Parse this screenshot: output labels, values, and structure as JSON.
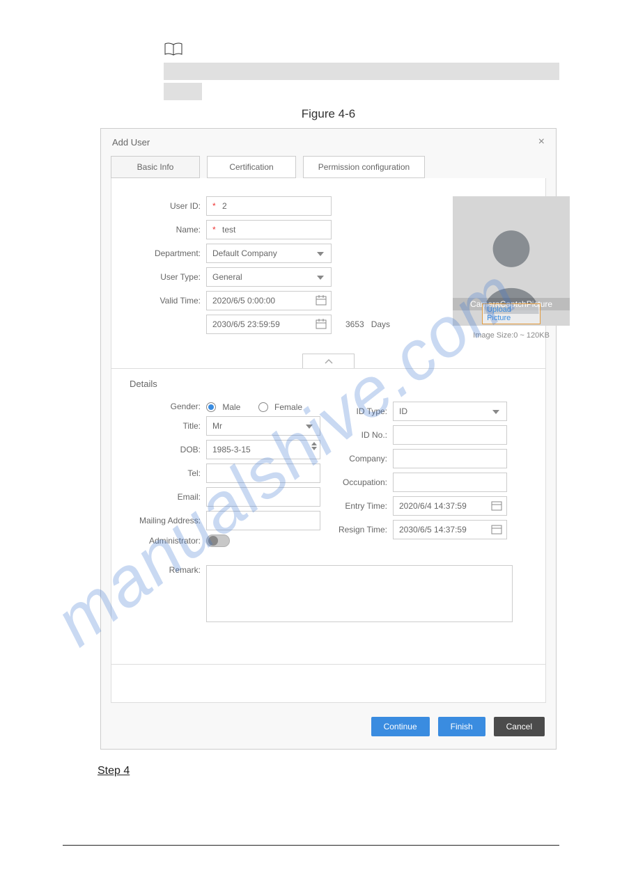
{
  "figure_caption": "Figure 4-6",
  "dialog": {
    "title": "Add User",
    "tabs": [
      "Basic Info",
      "Certification",
      "Permission configuration"
    ],
    "labels": {
      "user_id": "User ID:",
      "name": "Name:",
      "department": "Department:",
      "user_type": "User Type:",
      "valid_time": "Valid Time:",
      "days": "Days"
    },
    "values": {
      "user_id": "2",
      "name": "test",
      "department": "Default Company",
      "user_type": "General",
      "valid_from": "2020/6/5 0:00:00",
      "valid_to": "2030/6/5 23:59:59",
      "valid_days": "3653"
    },
    "photo": {
      "caption": "CameraCaptchPicture",
      "upload": "Upload Picture",
      "note": "Image Size:0 ~ 120KB"
    },
    "details": {
      "title": "Details",
      "labels": {
        "gender": "Gender:",
        "title": "Title:",
        "dob": "DOB:",
        "tel": "Tel:",
        "email": "Email:",
        "mailing": "Mailing Address:",
        "admin": "Administrator:",
        "remark": "Remark:",
        "id_type": "ID Type:",
        "id_no": "ID No.:",
        "company": "Company:",
        "occupation": "Occupation:",
        "entry": "Entry Time:",
        "resign": "Resign Time:"
      },
      "values": {
        "gender_male": "Male",
        "gender_female": "Female",
        "title": "Mr",
        "dob": "1985-3-15",
        "id_type": "ID",
        "entry": "2020/6/4 14:37:59",
        "resign": "2030/6/5 14:37:59"
      }
    },
    "buttons": {
      "continue": "Continue",
      "finish": "Finish",
      "cancel": "Cancel"
    }
  },
  "step4": "Step 4",
  "watermark": "manualshive.com"
}
